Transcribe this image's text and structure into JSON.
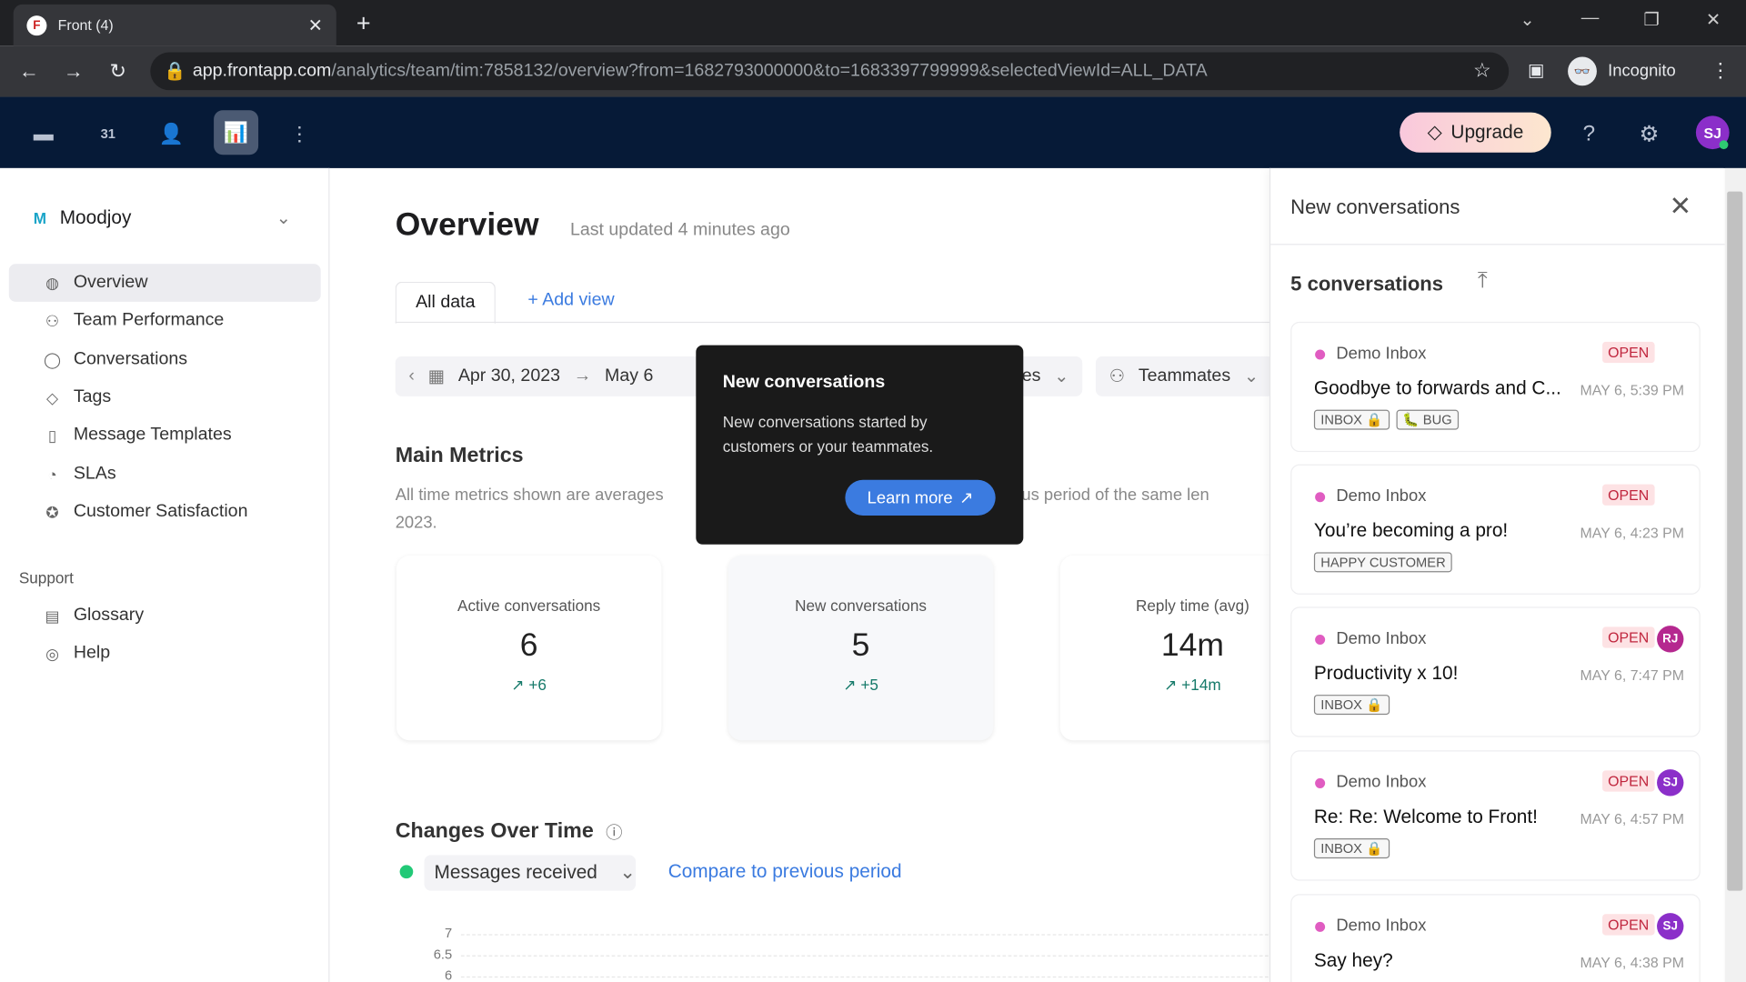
{
  "browser": {
    "tab_title": "Front (4)",
    "url_host": "app.frontapp.com",
    "url_path": "/analytics/team/tim:7858132/overview?from=1682793000000&to=1683397799999&selectedViewId=ALL_DATA",
    "profile": "Incognito"
  },
  "topbar": {
    "upgrade": "Upgrade",
    "calendar_day": "31",
    "avatar": "SJ"
  },
  "sidebar": {
    "workspace": "Moodjoy",
    "workspace_initial": "M",
    "items": [
      {
        "label": "Overview",
        "icon": "globe-icon"
      },
      {
        "label": "Team Performance",
        "icon": "people-icon"
      },
      {
        "label": "Conversations",
        "icon": "chat-icon"
      },
      {
        "label": "Tags",
        "icon": "tag-icon"
      },
      {
        "label": "Message Templates",
        "icon": "template-icon"
      },
      {
        "label": "SLAs",
        "icon": "timer-icon"
      },
      {
        "label": "Customer Satisfaction",
        "icon": "star-icon"
      }
    ],
    "support_label": "Support",
    "support_items": [
      {
        "label": "Glossary",
        "icon": "book-icon"
      },
      {
        "label": "Help",
        "icon": "lifebuoy-icon"
      }
    ]
  },
  "main": {
    "title": "Overview",
    "updated": "Last updated 4 minutes ago",
    "tabs": {
      "all": "All data",
      "add": "+ Add view"
    },
    "filters": {
      "start": "Apr 30, 2023",
      "end": "May 6",
      "inboxes_tail": "es",
      "teammates": "Teammates"
    },
    "metrics_title": "Main Metrics",
    "metrics_desc": "All time metrics shown are averages",
    "metrics_desc_tail": "evious period of the same len",
    "metrics_desc_line2": "2023.",
    "cards": [
      {
        "title": "Active conversations",
        "value": "6",
        "delta": "+6"
      },
      {
        "title": "New conversations",
        "value": "5",
        "delta": "+5"
      },
      {
        "title": "Reply time (avg)",
        "value": "14m",
        "delta": "+14m"
      }
    ],
    "changes_title": "Changes Over Time",
    "metric_select": "Messages received",
    "compare": "Compare to previous period"
  },
  "chart_data": {
    "type": "line",
    "series": [
      {
        "name": "Messages received",
        "values": []
      }
    ],
    "y_ticks": [
      "7",
      "6.5",
      "6"
    ],
    "series_color": "#22c977"
  },
  "tooltip": {
    "title": "New conversations",
    "body": "New conversations started by customers or your teammates.",
    "button": "Learn more"
  },
  "panel": {
    "title": "New conversations",
    "count": "5 conversations",
    "conversations": [
      {
        "inbox": "Demo Inbox",
        "status": "OPEN",
        "subject": "Goodbye to forwards and C...",
        "time": "MAY 6, 5:39 PM",
        "tags": [
          "INBOX 🔒",
          "🐛 BUG"
        ],
        "assignee": ""
      },
      {
        "inbox": "Demo Inbox",
        "status": "OPEN",
        "subject": "You’re becoming a pro!",
        "time": "MAY 6, 4:23 PM",
        "tags": [
          "HAPPY CUSTOMER"
        ],
        "assignee": ""
      },
      {
        "inbox": "Demo Inbox",
        "status": "OPEN",
        "subject": "Productivity x 10!",
        "time": "MAY 6, 7:47 PM",
        "tags": [
          "INBOX 🔒"
        ],
        "assignee": "RJ",
        "assignee_color": "#b5288f"
      },
      {
        "inbox": "Demo Inbox",
        "status": "OPEN",
        "subject": "Re: Re: Welcome to Front!",
        "time": "MAY 6, 4:57 PM",
        "tags": [
          "INBOX 🔒"
        ],
        "assignee": "SJ",
        "assignee_color": "#8b2fc9"
      },
      {
        "inbox": "Demo Inbox",
        "status": "OPEN",
        "subject": "Say hey?",
        "time": "MAY 6, 4:38 PM",
        "tags": [],
        "assignee": "SJ",
        "assignee_color": "#8b2fc9"
      }
    ]
  }
}
